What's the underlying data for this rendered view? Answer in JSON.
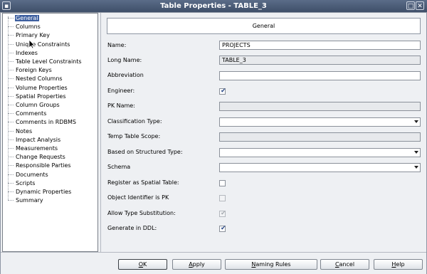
{
  "window": {
    "title": "Table Properties - TABLE_3"
  },
  "sysbuttons": {
    "menu": "▪",
    "max": "□",
    "close": "✕"
  },
  "nav": {
    "items": [
      {
        "label": "General",
        "selected": true
      },
      {
        "label": "Columns"
      },
      {
        "label": "Primary Key"
      },
      {
        "label": "Unique Constraints"
      },
      {
        "label": "Indexes"
      },
      {
        "label": "Table Level Constraints"
      },
      {
        "label": "Foreign Keys"
      },
      {
        "label": "Nested Columns"
      },
      {
        "label": "Volume Properties"
      },
      {
        "label": "Spatial Properties"
      },
      {
        "label": "Column Groups"
      },
      {
        "label": "Comments"
      },
      {
        "label": "Comments in RDBMS"
      },
      {
        "label": "Notes"
      },
      {
        "label": "Impact Analysis"
      },
      {
        "label": "Measurements"
      },
      {
        "label": "Change Requests"
      },
      {
        "label": "Responsible Parties"
      },
      {
        "label": "Documents"
      },
      {
        "label": "Scripts"
      },
      {
        "label": "Dynamic Properties"
      },
      {
        "label": "Summary"
      }
    ]
  },
  "panel": {
    "header": "General",
    "fields": {
      "name": {
        "label": "Name:",
        "value": "PROJECTS"
      },
      "long_name": {
        "label": "Long Name:",
        "value": "TABLE_3"
      },
      "abbreviation": {
        "label": "Abbreviation",
        "value": ""
      },
      "engineer": {
        "label": "Engineer:",
        "checked": true
      },
      "pk_name": {
        "label": "PK Name:",
        "value": ""
      },
      "classification_type": {
        "label": "Classification Type:",
        "value": ""
      },
      "temp_table_scope": {
        "label": "Temp Table Scope:",
        "value": ""
      },
      "based_on_structured_type": {
        "label": "Based on Structured Type:",
        "value": ""
      },
      "schema": {
        "label": "Schema",
        "value": ""
      },
      "register_as_spatial_table": {
        "label": "Register as Spatial Table:",
        "checked": false
      },
      "object_identifier_is_pk": {
        "label": "Object Identifier is PK",
        "checked": false
      },
      "allow_type_substitution": {
        "label": "Allow Type Substitution:",
        "checked": true
      },
      "generate_in_ddl": {
        "label": "Generate in DDL:",
        "checked": true
      }
    }
  },
  "buttons": {
    "ok": {
      "mnemonic": "O",
      "rest": "K"
    },
    "apply": {
      "mnemonic": "A",
      "rest": "pply"
    },
    "naming_rules": {
      "mnemonic": "N",
      "rest": "aming Rules"
    },
    "cancel": {
      "mnemonic": "C",
      "rest": "ancel"
    },
    "help": {
      "mnemonic": "H",
      "rest": "elp"
    }
  }
}
